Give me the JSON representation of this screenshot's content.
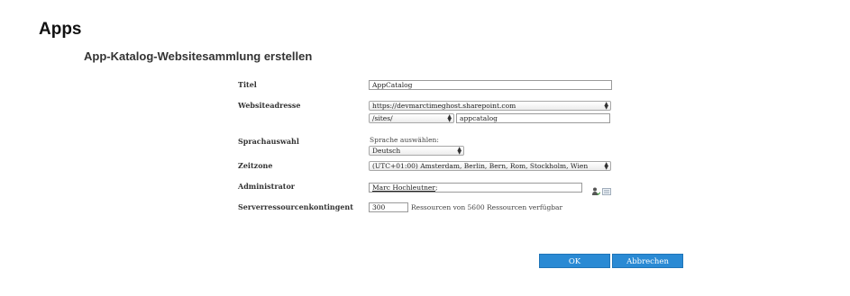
{
  "header": {
    "app_title": "Apps"
  },
  "page": {
    "title": "App-Katalog-Websitesammlung erstellen"
  },
  "form": {
    "title": {
      "label": "Titel",
      "value": "AppCatalog"
    },
    "website": {
      "label": "Websiteadresse",
      "host_value": "https://devmarctimeghost.sharepoint.com",
      "path_value": "/sites/",
      "url_suffix": "appcatalog"
    },
    "language": {
      "label": "Sprachauswahl",
      "hint": "Sprache auswählen:",
      "value": "Deutsch"
    },
    "timezone": {
      "label": "Zeitzone",
      "value": "(UTC+01:00) Amsterdam, Berlin, Bern, Rom, Stockholm, Wien"
    },
    "administrator": {
      "label": "Administrator",
      "value": "Marc Hochleutner",
      "separator": ";"
    },
    "quota": {
      "label": "Serverressourcenkontingent",
      "value": "300",
      "suffix": "Ressourcen von 5600 Ressourcen verfügbar"
    }
  },
  "buttons": {
    "ok": "OK",
    "cancel": "Abbrechen"
  },
  "icons": {
    "check_names": "person-check-icon",
    "browse": "address-book-icon"
  },
  "colors": {
    "button_bg": "#2a8ad4",
    "button_text": "#ffffff"
  }
}
